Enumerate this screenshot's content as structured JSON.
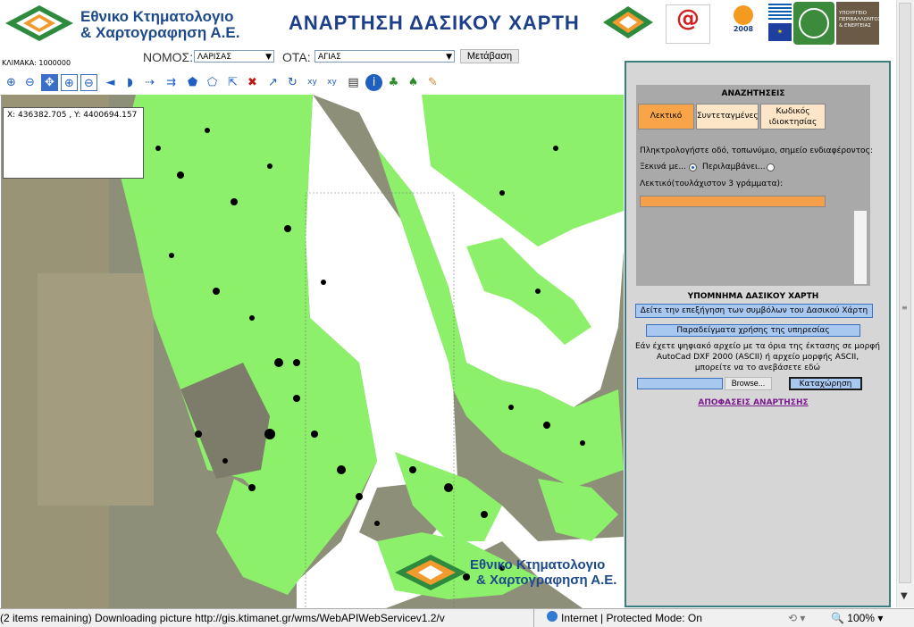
{
  "header": {
    "org_line1": "Εθνικο Κτηματολογιο",
    "org_line2": "& Χαρτογραφηση Α.Ε.",
    "page_title": "ΑΝΑΡΤΗΣΗ ΔΑΣΙΚΟΥ ΧΑΡΤΗ",
    "logo_epsilon": "@",
    "logo_hellas_year": "2008",
    "logo_ministry": "ΥΠΟΥΡΓΕΙΟ ΠΕΡΙΒΑΛΛΟΝΤΟΣ & ΕΝΕΡΓΕΙΑΣ"
  },
  "controls": {
    "scale": "ΚΛΙΜΑΚΑ: 1000000",
    "nomos_label": "ΝΟΜΟΣ:",
    "nomos_value": "ΛΑΡΙΣΑΣ",
    "ota_label": "ΟΤΑ:",
    "ota_value": "ΑΓΙΑΣ",
    "go_button": "Μετάβαση"
  },
  "toolbar": {
    "tools": [
      "zoom-in",
      "zoom-out",
      "pan",
      "zoom-box",
      "zoom-full",
      "back",
      "forward",
      "measure-distance",
      "measure-line",
      "polygon",
      "select-polygon",
      "select-pointer",
      "clear",
      "refresh",
      "identify-xy",
      "goto-xy",
      "print",
      "info",
      "tree",
      "tree-tree",
      "brush"
    ]
  },
  "map": {
    "coordinates": "X: 436382.705 , Y: 4400694.157",
    "watermark_line1": "Εθνικο Κτηματολογιο",
    "watermark_line2": "& Χαρτογραφηση Α.Ε."
  },
  "search": {
    "title": "ΑΝΑΖΗΤΗΣΕΙΣ",
    "tabs": [
      "Λεκτικό",
      "Συντεταγμένες",
      "Κωδικός ιδιοκτησίας"
    ],
    "instructions": "Πληκτρολογήστε οδό, τοπωνύμιο, σημείο ενδιαφέροντος:",
    "starts_with": "Ξεκινά με...",
    "contains": "Περιλαμβάνει...",
    "text_hint": "Λεκτικό(τουλάχιστον 3 γράμματα):",
    "text_value": ""
  },
  "legend": {
    "title": "ΥΠΟΜΝΗΜΑ ΔΑΣΙΚΟΥ ΧΑΡΤΗ",
    "symbols_button": "Δείτε την επεξήγηση των συμβόλων του Δασικού Χάρτη",
    "examples_button": "Παραδείγματα χρήσης της υπηρεσίας",
    "upload_text_1": "Εάν έχετε ψηφιακό αρχείο με τα όρια της έκτασης σε μορφή",
    "upload_text_2": "AutoCad DXF 2000 (ASCII) ή αρχείο μορφής ASCII,",
    "upload_text_3": "μπορείτε να το ανεβάσετε εδώ",
    "file_value": "",
    "browse_button": "Browse...",
    "submit_button": "Καταχώρηση",
    "decisions_link": "ΑΠΟΦΑΣΕΙΣ ΑΝΑΡΤΗΣΗΣ"
  },
  "status": {
    "message": "(2 items remaining) Downloading picture http://gis.ktimanet.gr/wms/WebAPIWebServicev1.2/v",
    "zone": "Internet | Protected Mode: On",
    "zoom": "100%"
  },
  "colors": {
    "forest_green": "#8cf06a",
    "title_blue": "#1d3f8a",
    "panel_border": "#3a7d7d",
    "tab_orange": "#f8a54a",
    "input_orange": "#f4a04a"
  }
}
